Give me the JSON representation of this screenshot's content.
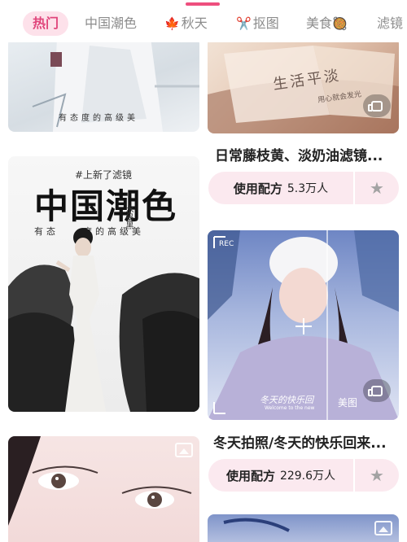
{
  "tabs": [
    {
      "label": "热门",
      "active": true
    },
    {
      "label": "中国潮色"
    },
    {
      "label": "秋天",
      "icon": "maple-leaf-icon",
      "icon_glyph": "🍁"
    },
    {
      "label": "抠图",
      "icon": "scissors-icon",
      "icon_glyph": "✂️"
    },
    {
      "label": "美食",
      "icon": "food-bowl-icon",
      "icon_glyph": "🥘"
    },
    {
      "label": "滤镜"
    }
  ],
  "cards": {
    "top_left": {
      "overlay_text": "有态度的高级美"
    },
    "top_right": {
      "overlay_line1": "生活平淡",
      "overlay_line2": "用心就会发光",
      "title": "日常藤枝黄、淡奶油滤镜...",
      "use_label": "使用配方",
      "use_count": "5.3万人"
    },
    "middle_left": {
      "tag": "#上新了滤镜",
      "big_title": "中国潮色",
      "small_title": "水墨黑",
      "subtitle": "有态　　度的高级美"
    },
    "middle_right": {
      "rec_label": "REC",
      "overlay_text": "冬天的快乐回",
      "overlay_en": "Welcome to the new",
      "side_label": "美图",
      "title": "冬天拍照/冬天的快乐回来...",
      "use_label": "使用配方",
      "use_count": "229.6万人"
    }
  },
  "colors": {
    "accent": "#e0457b",
    "button_bg": "#fbe9ef"
  }
}
